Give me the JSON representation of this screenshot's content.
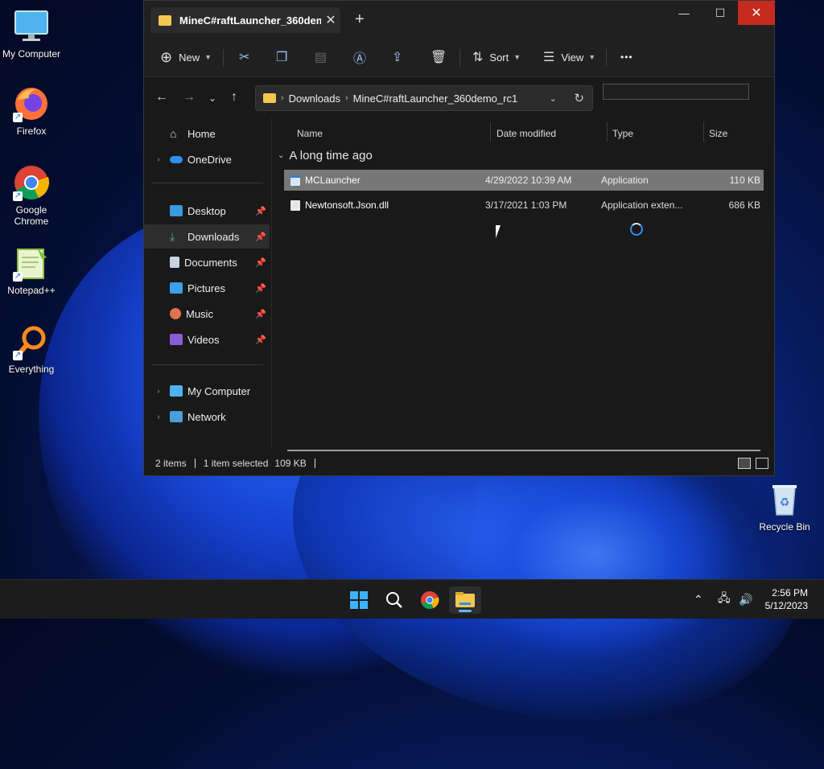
{
  "desktop": {
    "icons": [
      {
        "label": "My Computer"
      },
      {
        "label": "Firefox"
      },
      {
        "label": "Google Chrome"
      },
      {
        "label": "Notepad++"
      },
      {
        "label": "Everything"
      },
      {
        "label": "Recycle Bin"
      }
    ]
  },
  "window": {
    "tab_title": "MineC#raftLauncher_360dem",
    "controls": {
      "minimize": "—",
      "maximize": "☐",
      "close": "✕"
    }
  },
  "toolbar": {
    "new_label": "New",
    "sort_label": "Sort",
    "view_label": "View",
    "more_label": "•••"
  },
  "address": {
    "segments": [
      "Downloads",
      "MineC#raftLauncher_360demo_rc1"
    ],
    "search_placeholder": ""
  },
  "nav": {
    "items": [
      {
        "label": "Home"
      },
      {
        "label": "OneDrive"
      },
      {
        "label": "Desktop"
      },
      {
        "label": "Downloads"
      },
      {
        "label": "Documents"
      },
      {
        "label": "Pictures"
      },
      {
        "label": "Music"
      },
      {
        "label": "Videos"
      },
      {
        "label": "My Computer"
      },
      {
        "label": "Network"
      }
    ]
  },
  "files": {
    "columns": [
      "Name",
      "Date modified",
      "Type",
      "Size"
    ],
    "group_label": "A long time ago",
    "rows": [
      {
        "name": "MCLauncher",
        "date": "4/29/2022 10:39 AM",
        "type": "Application",
        "size": "110 KB"
      },
      {
        "name": "Newtonsoft.Json.dll",
        "date": "3/17/2021 1:03 PM",
        "type": "Application exten...",
        "size": "686 KB"
      }
    ]
  },
  "status": {
    "items_count": "2 items",
    "selection": "1 item selected",
    "selection_size": "109 KB"
  },
  "taskbar": {
    "time": "2:56 PM",
    "date": "5/12/2023"
  },
  "colors": {
    "accent": "#0078d4",
    "folder": "#f4c74f",
    "close_red": "#c42b1c"
  }
}
